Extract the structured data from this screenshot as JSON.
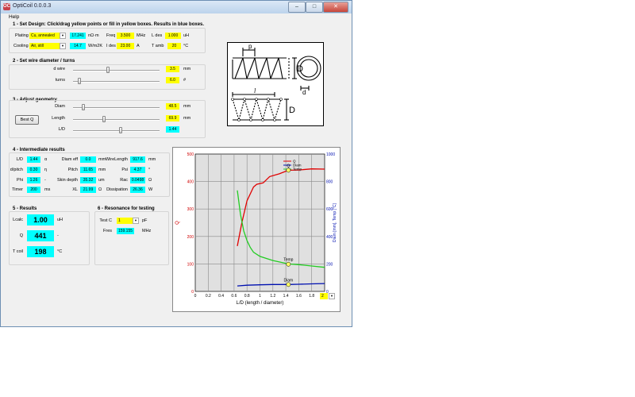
{
  "window": {
    "title": "OptiCoil 0.0.0.3",
    "app_icon": "OC",
    "min": "–",
    "max": "□",
    "close": "✕"
  },
  "menu": {
    "help": "Help"
  },
  "design": {
    "title": "1 - Set Design: Click/drag yellow points or fill in yellow boxes. Results in blue boxes.",
    "plating_label": "Plating",
    "plating_value": "Cu, annealed",
    "plating_res": "17.241",
    "plating_res_unit": "nΩ·m",
    "freq_label": "Freq",
    "freq_value": "3.500",
    "freq_unit": "MHz",
    "ldes_label": "L des",
    "ldes_value": "1.000",
    "ldes_unit": "uH",
    "cooling_label": "Cooling",
    "cooling_value": "Air, still",
    "cooling_coef": "14.7",
    "cooling_unit": "W/m2K",
    "ides_label": "I des",
    "ides_value": "23.00",
    "ides_unit": "A",
    "tamb_label": "T amb",
    "tamb_value": "20",
    "tamb_unit": "°C"
  },
  "wire": {
    "title": "2 - Set wire diameter / turns",
    "dwire_label": "d wire",
    "dwire_value": "3.5",
    "dwire_unit": "mm",
    "dwire_pos": 0.4,
    "turns_label": "turns",
    "turns_value": "6.0",
    "turns_unit": "#",
    "turns_pos": 0.06
  },
  "geometry": {
    "title": "3 - Adjust geometry",
    "best_q": "Best Q",
    "diam_label": "Diam",
    "diam_value": "48.5",
    "diam_unit": "mm",
    "diam_pos": 0.1,
    "length_label": "Length",
    "length_value": "69.9",
    "length_unit": "mm",
    "length_pos": 0.35,
    "ld_label": "L/D",
    "ld_value": "1.44",
    "ld_pos": 0.55
  },
  "intermediate": {
    "title": "4 - Intermediate results",
    "ld_label": "L/D",
    "ld_value": "1.44",
    "ld_unit": "α",
    "dpitch_label": "d/pitch",
    "dpitch_value": "0.30",
    "dpitch_unit": "η",
    "phi_label": "Phi",
    "phi_value": "1.26",
    "phi_unit": "-",
    "timer_label": "Timer",
    "timer_value": "200",
    "timer_unit": "ms",
    "diameff_label": "Diam eff",
    "diameff_value": "0.0",
    "diameff_unit": "mm",
    "pitch_label": "Pitch",
    "pitch_value": "11.65",
    "pitch_unit": "mm",
    "skin_label": "Skin depth",
    "skin_value": "35.32",
    "skin_unit": "um",
    "xl_label": "XL",
    "xl_value": "21.99",
    "xl_unit": "Ω",
    "wirelen_label": "WireLength",
    "wirelen_value": "917.6",
    "wirelen_unit": "mm",
    "psi_label": "Psi",
    "psi_value": "4.37",
    "psi_unit": "°",
    "rac_label": "Rac",
    "rac_value": "0.0498",
    "rac_unit": "Ω",
    "diss_label": "Dissipation",
    "diss_value": "26.36",
    "diss_unit": "W"
  },
  "results": {
    "title": "5 - Results",
    "lcalc_label": "Lcalc",
    "lcalc_value": "1.00",
    "lcalc_unit": "uH",
    "q_label": "Q",
    "q_value": "441",
    "q_unit": "-",
    "tcoil_label": "T coil",
    "tcoil_value": "198",
    "tcoil_unit": "°C"
  },
  "resonance": {
    "title": "6 - Resonance for testing",
    "testc_label": "Test C",
    "testc_value": "1",
    "testc_unit": "pF",
    "fres_label": "Fres",
    "fres_value": "159.155",
    "fres_unit": "MHz"
  },
  "diagram": {
    "p": "p",
    "D": "D",
    "d": "d",
    "l": "l"
  },
  "chart_data": {
    "type": "line",
    "xlabel": "L/D (length / diameter)",
    "ylabel_left": "Q",
    "ylabel_right": "Diam [mm], Temp [°C]",
    "xlim": [
      0,
      2
    ],
    "ylim_left": [
      0,
      500
    ],
    "ylim_right": [
      0,
      1000
    ],
    "x_ticks": [
      "0",
      "0.2",
      "0.4",
      "0.6",
      "0.8",
      "1",
      "1.2",
      "1.4",
      "1.6",
      "1.8",
      "2"
    ],
    "yl_ticks": [
      "0",
      "100",
      "200",
      "300",
      "400",
      "500"
    ],
    "yr_ticks": [
      "0",
      "200",
      "400",
      "600",
      "800",
      "1000"
    ],
    "x_select": "2",
    "colors": {
      "q": "#e00000",
      "diam": "#0010b0",
      "temp": "#22cc22",
      "marker": "#ffff66"
    },
    "series": [
      {
        "name": "Q",
        "axis": "left",
        "x": [
          0.65,
          0.72,
          0.8,
          0.9,
          0.95,
          1.05,
          1.15,
          1.3,
          1.44,
          1.6,
          1.8,
          2.0
        ],
        "y": [
          165,
          250,
          330,
          380,
          390,
          395,
          418,
          428,
          441,
          442,
          446,
          445
        ]
      },
      {
        "name": "Diam",
        "axis": "right",
        "x": [
          0.65,
          0.8,
          1.0,
          1.2,
          1.44,
          1.6,
          1.8,
          2.0
        ],
        "y": [
          40,
          45,
          48,
          50,
          50,
          52,
          55,
          57
        ]
      },
      {
        "name": "Temp",
        "axis": "right",
        "x": [
          0.65,
          0.7,
          0.75,
          0.8,
          0.85,
          0.9,
          1.0,
          1.2,
          1.44,
          1.6,
          1.8,
          2.0
        ],
        "y": [
          735,
          560,
          440,
          370,
          320,
          285,
          255,
          225,
          200,
          195,
          185,
          175
        ]
      }
    ],
    "annotations": [
      {
        "text": "Q",
        "x": 1.44,
        "y": 441,
        "axis": "left"
      },
      {
        "text": "Temp",
        "x": 1.44,
        "y": 198,
        "axis": "right"
      },
      {
        "text": "Diam",
        "x": 1.44,
        "y": 50,
        "axis": "right"
      }
    ]
  }
}
